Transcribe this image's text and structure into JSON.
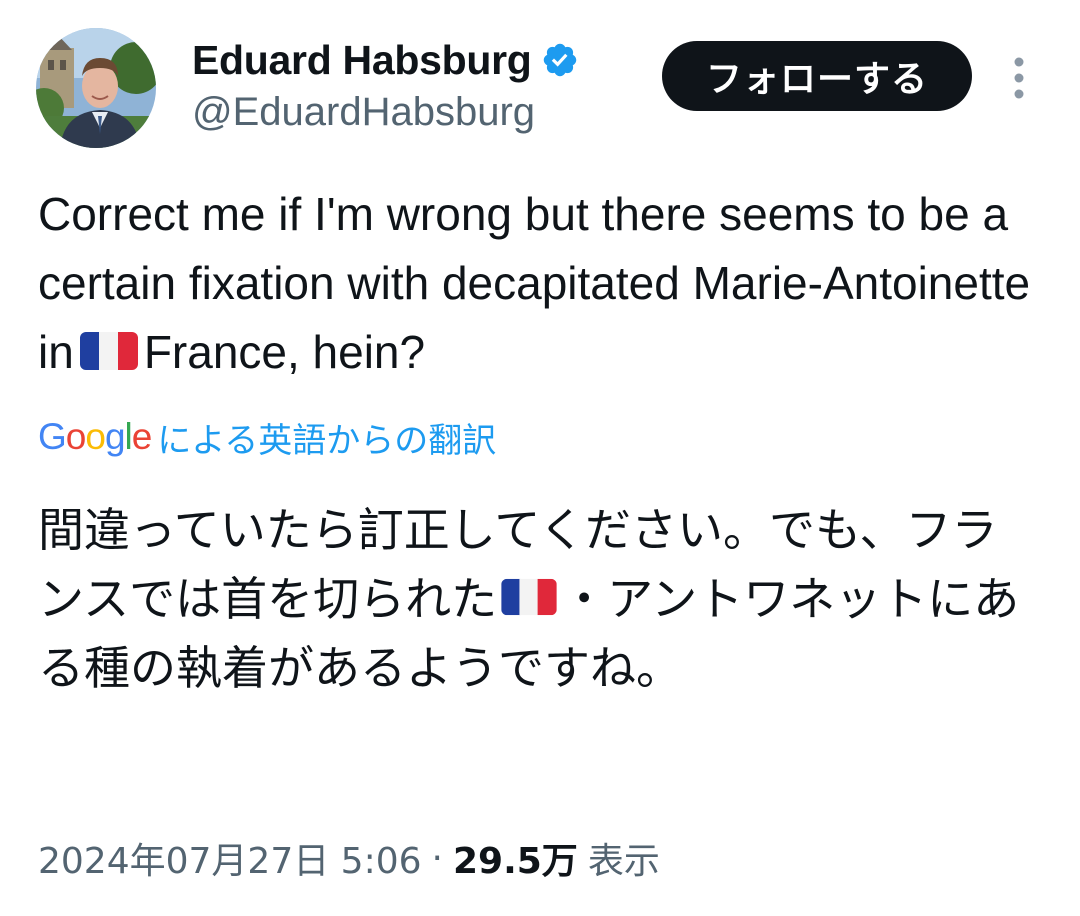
{
  "author": {
    "display_name": "Eduard Habsburg",
    "handle": "@EduardHabsburg",
    "verified": true
  },
  "follow_button_label": "フォローする",
  "more_icon": "vertical-ellipsis-icon",
  "tweet": {
    "text_parts": [
      "Correct me if I'm wrong but there seems to be a certain fixation with decapitated Marie-Antoinette in",
      "France, hein?"
    ],
    "flag_icon": "france-flag-emoji"
  },
  "translation": {
    "provider_letters": [
      "G",
      "o",
      "o",
      "g",
      "l",
      "e"
    ],
    "provider_colors": [
      "#4285F4",
      "#EA4335",
      "#FBBC05",
      "#4285F4",
      "#34A853",
      "#EA4335"
    ],
    "label": "による英語からの翻訳",
    "text_parts": [
      "間違っていたら訂正してください。でも、フランスでは首を切られた",
      "・アントワネットにある種の執着があるようですね。"
    ]
  },
  "meta": {
    "timestamp": "2024年07月27日 5:06",
    "separator": "·",
    "views_count": "29.5万",
    "views_label": "表示"
  },
  "colors": {
    "accent_blue": "#1d9bf0",
    "text_primary": "#0f1419",
    "text_secondary": "#536471",
    "follow_bg": "#0f1419"
  }
}
